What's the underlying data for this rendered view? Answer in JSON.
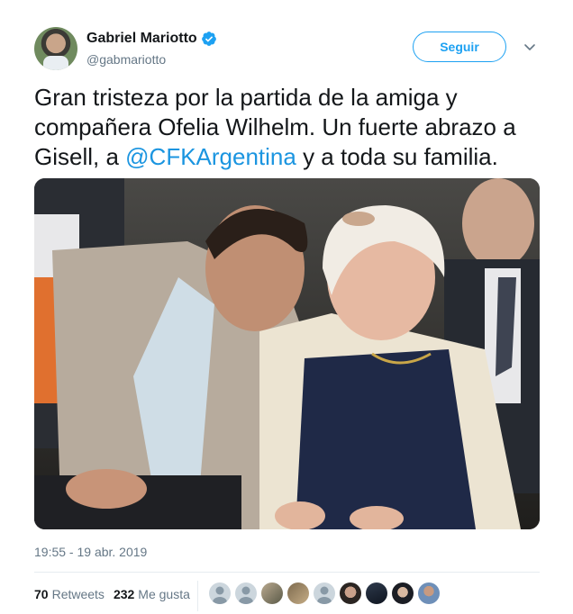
{
  "author": {
    "display_name": "Gabriel Mariotto",
    "handle": "@gabmariotto",
    "verified": true,
    "verified_icon": "verified-badge-icon"
  },
  "actions": {
    "follow_label": "Seguir",
    "more_icon": "chevron-down-icon"
  },
  "tweet": {
    "text_before": "Gran tristeza por la partida de la amiga y compañera Ofelia Wilhelm. Un fuerte abrazo a Gisell, a ",
    "mention": "@CFKArgentina",
    "text_after": " y a toda su familia.",
    "timestamp": "19:55 - 19 abr. 2019"
  },
  "stats": {
    "retweets_count": "70",
    "retweets_label": "Retweets",
    "likes_count": "232",
    "likes_label": "Me gusta"
  },
  "likers": [
    "default-avatar",
    "default-avatar",
    "photo-avatar",
    "photo-avatar",
    "default-avatar",
    "photo-avatar",
    "photo-avatar",
    "photo-avatar",
    "photo-avatar"
  ],
  "colors": {
    "accent": "#1da1f2",
    "link": "#1b95e0",
    "text": "#14171a",
    "muted": "#657786"
  }
}
